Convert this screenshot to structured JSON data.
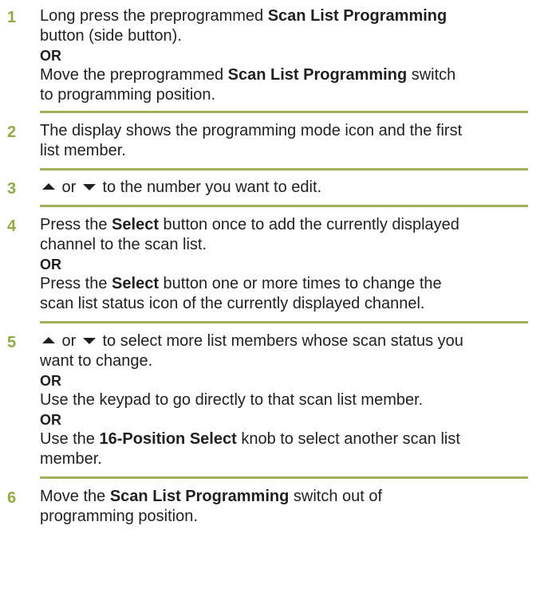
{
  "accent_color": "#8faa46",
  "steps": [
    {
      "number": "1",
      "l1a": "Long press the preprogrammed ",
      "l1b": "Scan List Programming",
      "l2": "button (side button).",
      "or": "OR",
      "l3a": "Move the preprogrammed ",
      "l3b": "Scan List Programming",
      "l3c": " switch",
      "l4": "to programming position."
    },
    {
      "number": "2",
      "l1": "The display shows the programming mode icon and the first",
      "l2": "list member."
    },
    {
      "number": "3",
      "up_icon": "up-arrow-icon",
      "or_word": " or ",
      "down_icon": "down-arrow-icon",
      "l1": " to the number you want to edit."
    },
    {
      "number": "4",
      "l1a": "Press the ",
      "l1b": "Select",
      "l1c": " button once to add the currently displayed",
      "l2": "channel to the scan list.",
      "or": "OR",
      "l3a": "Press the ",
      "l3b": "Select",
      "l3c": " button one or more times to change the",
      "l4": "scan list status icon of the currently displayed channel."
    },
    {
      "number": "5",
      "or_word": " or ",
      "l1": " to select more list members whose scan status you",
      "l2": "want to change.",
      "or1": "OR",
      "l3": "Use the keypad to go directly to that scan list member.",
      "or2": "OR",
      "l4a": "Use the ",
      "l4b": "16-Position Select",
      "l4c": " knob to select another scan list",
      "l5": "member."
    },
    {
      "number": "6",
      "l1a": "Move the ",
      "l1b": "Scan List Programming",
      "l1c": " switch out of",
      "l2": "programming position."
    }
  ]
}
